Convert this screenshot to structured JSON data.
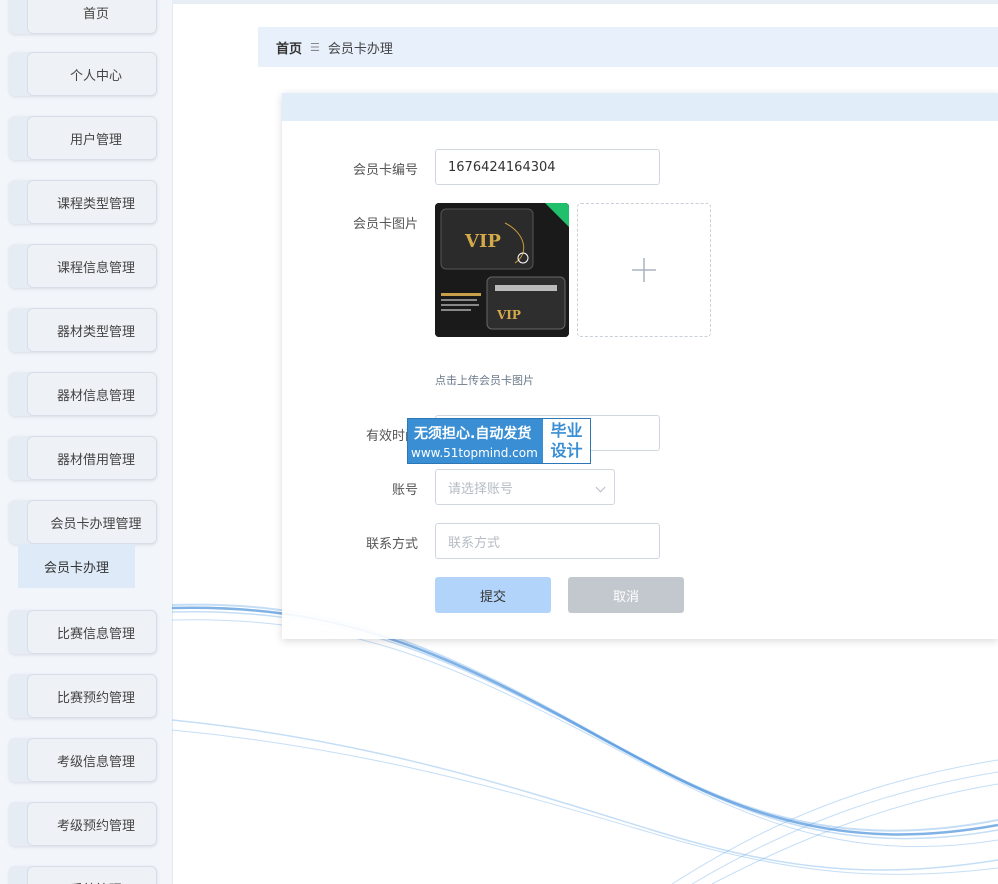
{
  "sidebar": {
    "items": [
      {
        "label": "首页"
      },
      {
        "label": "个人中心"
      },
      {
        "label": "用户管理"
      },
      {
        "label": "课程类型管理"
      },
      {
        "label": "课程信息管理"
      },
      {
        "label": "器材类型管理"
      },
      {
        "label": "器材信息管理"
      },
      {
        "label": "器材借用管理"
      },
      {
        "label": "会员卡办理管理"
      },
      {
        "label": "比赛信息管理"
      },
      {
        "label": "比赛预约管理"
      },
      {
        "label": "考级信息管理"
      },
      {
        "label": "考级预约管理"
      },
      {
        "label": "系统管理"
      }
    ],
    "subitem": {
      "label": "会员卡办理"
    }
  },
  "breadcrumb": {
    "home": "首页",
    "separator": "☰",
    "current": "会员卡办理"
  },
  "form": {
    "card_number": {
      "label": "会员卡编号",
      "value": "1676424164304"
    },
    "card_image": {
      "label": "会员卡图片",
      "hint": "点击上传会员卡图片",
      "upload_icon": "plus-icon"
    },
    "validity": {
      "label": "有效时间",
      "value": ""
    },
    "account": {
      "label": "账号",
      "placeholder": "请选择账号"
    },
    "contact": {
      "label": "联系方式",
      "placeholder": "联系方式"
    },
    "submit_label": "提交",
    "cancel_label": "取消"
  },
  "watermark": {
    "line1": "无须担心.自动发货",
    "line2": "www.51topmind.com",
    "side_top": "毕业",
    "side_bottom": "设计"
  },
  "colors": {
    "accent": "#b3d4fa",
    "sidebar_bg": "#f2f6fb",
    "breadcrumb_bg": "#e7f0fb",
    "watermark": "#3a8fd4"
  }
}
